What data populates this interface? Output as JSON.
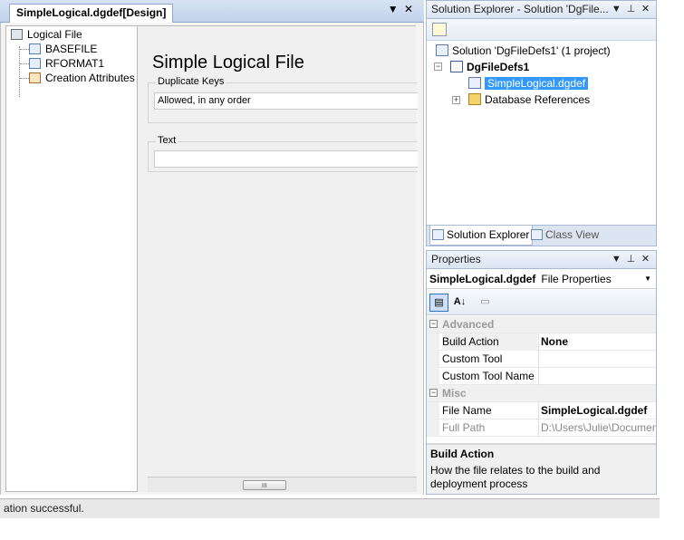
{
  "document": {
    "tab_title": "SimpleLogical.dgdef[Design]",
    "dropdown_glyph": "▼",
    "close_glyph": "✕"
  },
  "tree": {
    "root": "Logical File",
    "children": [
      "BASEFILE",
      "RFORMAT1",
      "Creation Attributes"
    ]
  },
  "form": {
    "title": "Simple Logical File",
    "duplicate_keys_label": "Duplicate Keys",
    "duplicate_keys_value": "Allowed, in any order",
    "text_label": "Text",
    "text_value": "",
    "scroll_grip": "III"
  },
  "solution_explorer": {
    "title": "Solution Explorer - Solution 'DgFile...",
    "solution_label": "Solution 'DgFileDefs1' (1 project)",
    "project_label": "DgFileDefs1",
    "selected_file": "SimpleLogical.dgdef",
    "references_label": "Database References",
    "tab_active": "Solution Explorer",
    "tab_inactive": "Class View",
    "pin_glyph": "⊥",
    "dropdown_glyph": "▼",
    "close_glyph": "✕"
  },
  "properties": {
    "title": "Properties",
    "object_name": "SimpleLogical.dgdef",
    "object_type": "File Properties",
    "categorized_glyph": "▤",
    "alpha_glyph": "A↓",
    "pages_glyph": "▭",
    "categories": [
      {
        "name": "Advanced",
        "rows": [
          {
            "name": "Build Action",
            "value": "None"
          },
          {
            "name": "Custom Tool",
            "value": ""
          },
          {
            "name": "Custom Tool Name",
            "value": ""
          }
        ]
      },
      {
        "name": "Misc",
        "rows": [
          {
            "name": "File Name",
            "value": "SimpleLogical.dgdef"
          },
          {
            "name": "Full Path",
            "value": "D:\\Users\\Julie\\Documen"
          }
        ]
      }
    ],
    "description_title": "Build Action",
    "description_text": "How the file relates to the build and deployment process"
  },
  "status": {
    "text": "ation successful."
  }
}
